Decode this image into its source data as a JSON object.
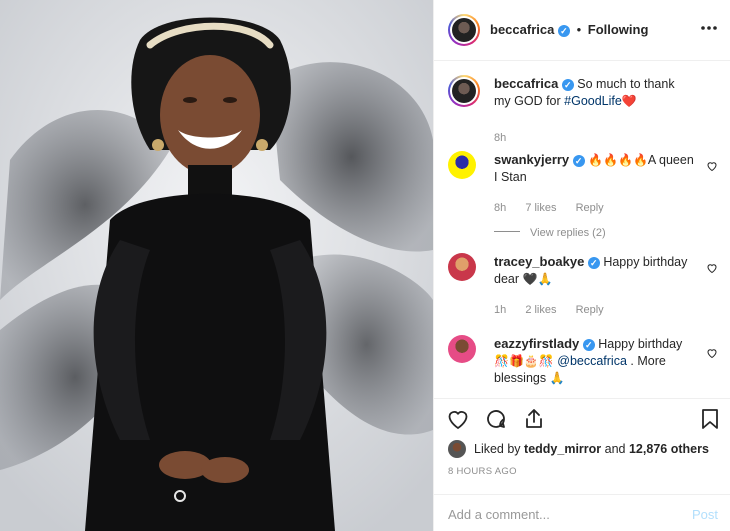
{
  "header": {
    "username": "beccafrica",
    "follow_status": "Following",
    "separator": "•",
    "more_icon": "more-icon"
  },
  "caption": {
    "username": "beccafrica",
    "text_before": "So much to thank my GOD for ",
    "hashtag": "#GoodLife",
    "emoji": "❤️",
    "time": "8h"
  },
  "comments": [
    {
      "username": "swankyjerry",
      "emojis": "🔥🔥🔥🔥",
      "text": "A queen I Stan",
      "time": "8h",
      "likes": "7 likes",
      "reply": "Reply",
      "view_replies": "View replies (2)"
    },
    {
      "username": "tracey_boakye",
      "text": "Happy birthday dear",
      "emojis": "🖤🙏",
      "time": "1h",
      "likes": "2 likes",
      "reply": "Reply"
    },
    {
      "username": "eazzyfirstlady",
      "text": "Happy birthday",
      "emojis": "🎊🎁🎂🎊",
      "mention": "@beccafrica",
      "text2": ". More blessings",
      "emoji_end": "🙏"
    }
  ],
  "likes": {
    "prefix": "Liked by",
    "user": "teddy_mirror",
    "middle": "and",
    "count": "12,876 others"
  },
  "timestamp": "8 HOURS AGO",
  "add_comment": {
    "placeholder": "Add a comment...",
    "post_label": "Post"
  },
  "colors": {
    "verified": "#3897f0",
    "muted": "#8e8e8e",
    "link": "#003569",
    "post_disabled": "#b2dffc"
  }
}
